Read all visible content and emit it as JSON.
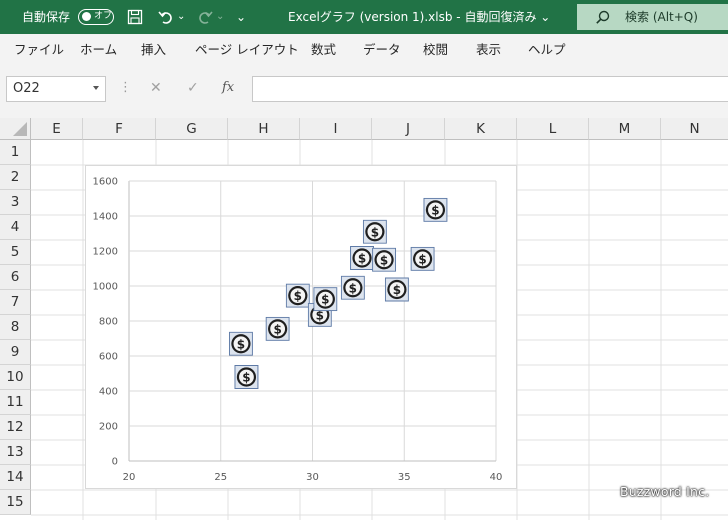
{
  "titlebar": {
    "autosave_label": "自動保存",
    "autosave_state": "オフ",
    "qat_more": "⌄",
    "file_title": "Excelグラフ (version 1).xlsb  -  自動回復済み  ⌄",
    "search_label": "検索 (Alt+Q)"
  },
  "menu": [
    "ファイル",
    "ホーム",
    "挿入",
    "ページ レイアウト",
    "数式",
    "データ",
    "校閲",
    "表示",
    "ヘルプ"
  ],
  "formula_bar": {
    "name_box": "O22",
    "fx_label": "fx"
  },
  "columns": [
    "E",
    "F",
    "G",
    "H",
    "I",
    "J",
    "K",
    "L",
    "M",
    "N"
  ],
  "rows": [
    "1",
    "2",
    "3",
    "4",
    "5",
    "6",
    "7",
    "8",
    "9",
    "10",
    "11",
    "12",
    "13",
    "14",
    "15"
  ],
  "chart_data": {
    "type": "scatter",
    "marker": "dollar-icon",
    "x_ticks": [
      "20",
      "25",
      "30",
      "35",
      "40"
    ],
    "y_ticks": [
      "0",
      "200",
      "400",
      "600",
      "800",
      "1000",
      "1200",
      "1400",
      "1600"
    ],
    "xlim": [
      20,
      40
    ],
    "ylim": [
      0,
      1600
    ],
    "grid": true,
    "points": [
      {
        "x": 26.1,
        "y": 670
      },
      {
        "x": 26.4,
        "y": 480
      },
      {
        "x": 28.1,
        "y": 755
      },
      {
        "x": 29.2,
        "y": 945
      },
      {
        "x": 30.4,
        "y": 835
      },
      {
        "x": 30.7,
        "y": 925
      },
      {
        "x": 32.2,
        "y": 990
      },
      {
        "x": 32.7,
        "y": 1160
      },
      {
        "x": 33.4,
        "y": 1310
      },
      {
        "x": 33.9,
        "y": 1150
      },
      {
        "x": 34.6,
        "y": 980
      },
      {
        "x": 36.0,
        "y": 1155
      },
      {
        "x": 36.7,
        "y": 1435
      }
    ]
  },
  "watermark": "Buzzword Inc."
}
